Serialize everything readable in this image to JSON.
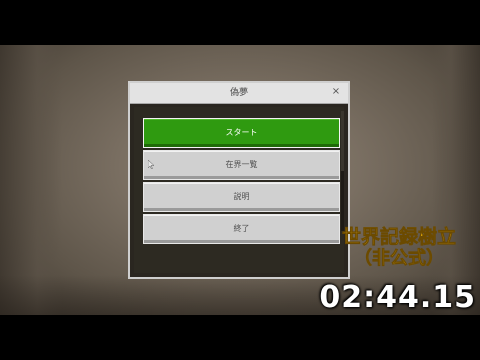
{
  "dialog": {
    "title": "偽夢",
    "close_glyph": "×"
  },
  "menu": {
    "items": [
      {
        "label": "スタート",
        "style": "primary"
      },
      {
        "label": "在界一覧",
        "style": "default"
      },
      {
        "label": "説明",
        "style": "default"
      },
      {
        "label": "終了",
        "style": "default"
      }
    ]
  },
  "overlay": {
    "record_line1": "世界記録樹立",
    "record_line2": "（非公式）",
    "timer": "02:44.15"
  },
  "colors": {
    "primary_button": "#2f9a10",
    "default_button": "#d0d0d0",
    "record_text": "#f5b80d",
    "timer_text": "#ffffff"
  },
  "icons": {
    "close": "close-icon",
    "pointer": "mouse-pointer-icon"
  }
}
